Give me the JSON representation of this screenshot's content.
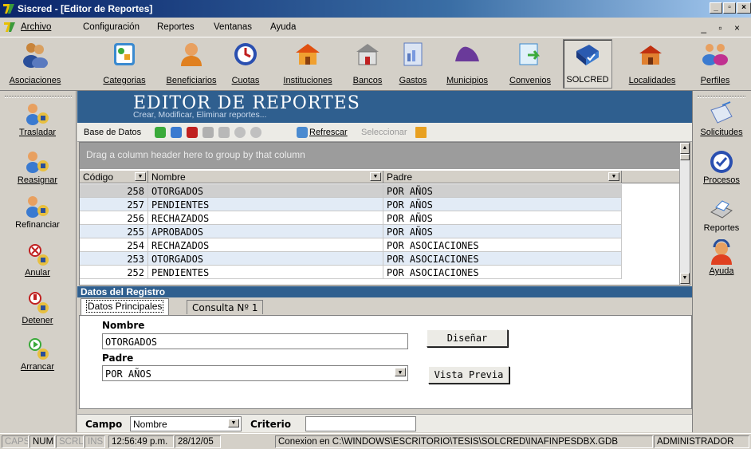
{
  "window": {
    "app": "Siscred",
    "title": "Siscred - [Editor de Reportes]"
  },
  "menubar": {
    "items": [
      "Archivo",
      "Configuración",
      "Reportes",
      "Ventanas",
      "Ayuda"
    ]
  },
  "toolbar": {
    "items": [
      "Asociaciones",
      "Categorias",
      "Beneficiarios",
      "Cuotas",
      "Instituciones",
      "Bancos",
      "Gastos",
      "Municipios",
      "Convenios",
      "SOLCRED",
      "Localidades",
      "Perfiles"
    ]
  },
  "left_sidebar": {
    "items": [
      "Trasladar",
      "Reasignar",
      "Refinanciar",
      "Anular",
      "Detener",
      "Arrancar"
    ]
  },
  "right_sidebar": {
    "items": [
      "Solicitudes",
      "Procesos",
      "Reportes",
      "Ayuda"
    ]
  },
  "editor": {
    "title": "EDITOR DE REPORTES",
    "subtitle": "Crear, Modificar, Eliminar reportes...",
    "db_label": "Base de Datos",
    "refresh": "Refrescar",
    "select": "Seleccionar"
  },
  "grid": {
    "group_hint": "Drag a column header here to group by that column",
    "columns": [
      "Código",
      "Nombre",
      "Padre"
    ],
    "rows": [
      {
        "codigo": "258",
        "nombre": "OTORGADOS",
        "padre": "POR AÑOS"
      },
      {
        "codigo": "257",
        "nombre": "PENDIENTES",
        "padre": "POR AÑOS"
      },
      {
        "codigo": "256",
        "nombre": "RECHAZADOS",
        "padre": "POR AÑOS"
      },
      {
        "codigo": "255",
        "nombre": "APROBADOS",
        "padre": "POR AÑOS"
      },
      {
        "codigo": "254",
        "nombre": "RECHAZADOS",
        "padre": "POR ASOCIACIONES"
      },
      {
        "codigo": "253",
        "nombre": "OTORGADOS",
        "padre": "POR ASOCIACIONES"
      },
      {
        "codigo": "252",
        "nombre": "PENDIENTES",
        "padre": "POR ASOCIACIONES"
      }
    ]
  },
  "details": {
    "section_title": "Datos del Registro",
    "tabs": [
      "Datos Principales",
      "Consulta Nº 1"
    ],
    "nombre_label": "Nombre",
    "nombre_value": "OTORGADOS",
    "padre_label": "Padre",
    "padre_value": "POR AÑOS",
    "design_button": "Diseñar",
    "preview_button": "Vista Previa"
  },
  "filter": {
    "campo_label": "Campo",
    "campo_value": "Nombre",
    "criterio_label": "Criterio",
    "criterio_value": ""
  },
  "statusbar": {
    "caps": "CAPS",
    "num": "NUM",
    "scrl": "SCRL",
    "ins": "INS",
    "time": "12:56:49 p.m.",
    "date": "28/12/05",
    "connection": "Conexion en C:\\WINDOWS\\ESCRITORIO\\TESIS\\SOLCRED\\INAFINPESDBX.GDB",
    "user": "ADMINISTRADOR"
  }
}
